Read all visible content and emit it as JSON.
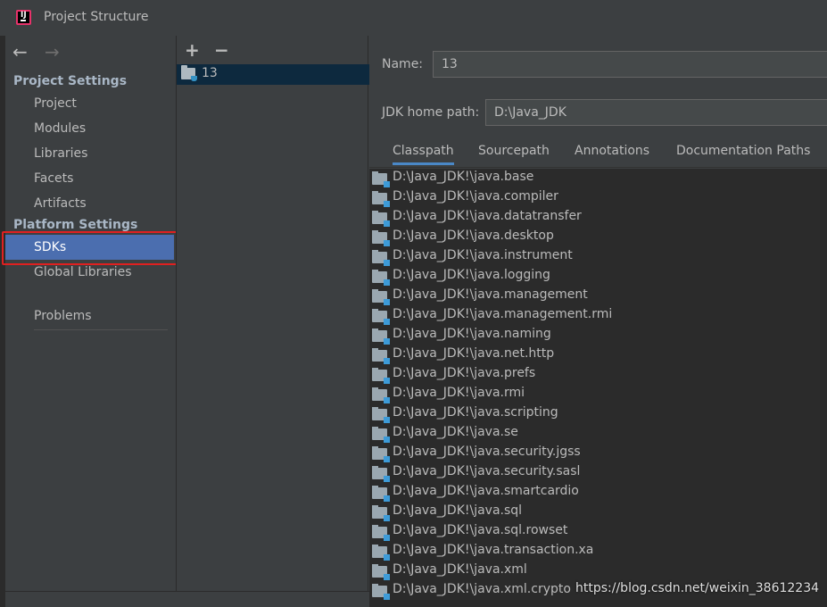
{
  "window": {
    "title": "Project Structure",
    "logo_text": "IJ"
  },
  "nav": {
    "back": "←",
    "forward": "→"
  },
  "sidebar": {
    "project_settings_heading": "Project Settings",
    "project_items": [
      "Project",
      "Modules",
      "Libraries",
      "Facets",
      "Artifacts"
    ],
    "platform_settings_heading": "Platform Settings",
    "platform_items": [
      "SDKs",
      "Global Libraries"
    ],
    "selected": "SDKs",
    "problems": "Problems"
  },
  "sdk_list": {
    "add": "+",
    "remove": "−",
    "items": [
      "13"
    ]
  },
  "detail": {
    "name_label": "Name:",
    "name_value": "13",
    "home_label": "JDK home path:",
    "home_value": "D:\\Java_JDK",
    "tabs": [
      "Classpath",
      "Sourcepath",
      "Annotations",
      "Documentation Paths"
    ],
    "active_tab": "Classpath"
  },
  "classpath": [
    "D:\\Java_JDK!\\java.base",
    "D:\\Java_JDK!\\java.compiler",
    "D:\\Java_JDK!\\java.datatransfer",
    "D:\\Java_JDK!\\java.desktop",
    "D:\\Java_JDK!\\java.instrument",
    "D:\\Java_JDK!\\java.logging",
    "D:\\Java_JDK!\\java.management",
    "D:\\Java_JDK!\\java.management.rmi",
    "D:\\Java_JDK!\\java.naming",
    "D:\\Java_JDK!\\java.net.http",
    "D:\\Java_JDK!\\java.prefs",
    "D:\\Java_JDK!\\java.rmi",
    "D:\\Java_JDK!\\java.scripting",
    "D:\\Java_JDK!\\java.se",
    "D:\\Java_JDK!\\java.security.jgss",
    "D:\\Java_JDK!\\java.security.sasl",
    "D:\\Java_JDK!\\java.smartcardio",
    "D:\\Java_JDK!\\java.sql",
    "D:\\Java_JDK!\\java.sql.rowset",
    "D:\\Java_JDK!\\java.transaction.xa",
    "D:\\Java_JDK!\\java.xml",
    "D:\\Java_JDK!\\java.xml.crypto"
  ],
  "watermark": "https://blog.csdn.net/weixin_38612234",
  "colors": {
    "selection": "#4b6eaf",
    "highlight_box": "#e02020",
    "tab_underline": "#4a88c7"
  }
}
